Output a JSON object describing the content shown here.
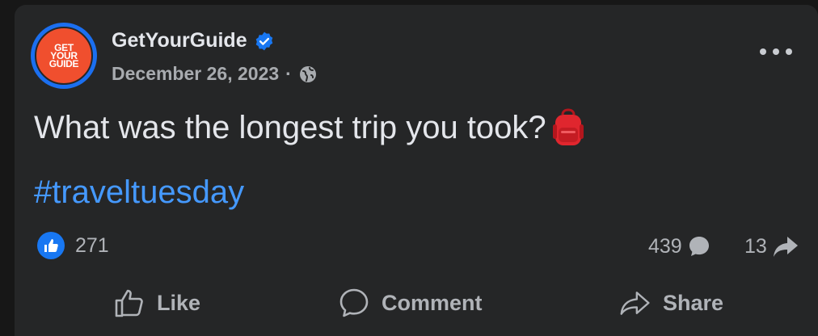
{
  "post": {
    "author": "GetYourGuide",
    "avatar_text": [
      "GET",
      "YOUR",
      "GUIDE"
    ],
    "date": "December 26, 2023",
    "separator": "·",
    "text": "What was the longest trip you took?",
    "hashtag": "#traveltuesday"
  },
  "stats": {
    "likes": "271",
    "comments": "439",
    "shares": "13"
  },
  "actions": {
    "like": "Like",
    "comment": "Comment",
    "share": "Share"
  },
  "colors": {
    "background": "#252627",
    "accent": "#1877f2",
    "hashtag": "#4599ff",
    "brand": "#f04f2e"
  },
  "icons": [
    "verified-icon",
    "globe-icon",
    "more-icon",
    "backpack-emoji-icon",
    "like-reaction-icon",
    "comment-count-icon",
    "share-count-icon",
    "thumbs-up-icon",
    "comment-icon",
    "share-icon"
  ]
}
